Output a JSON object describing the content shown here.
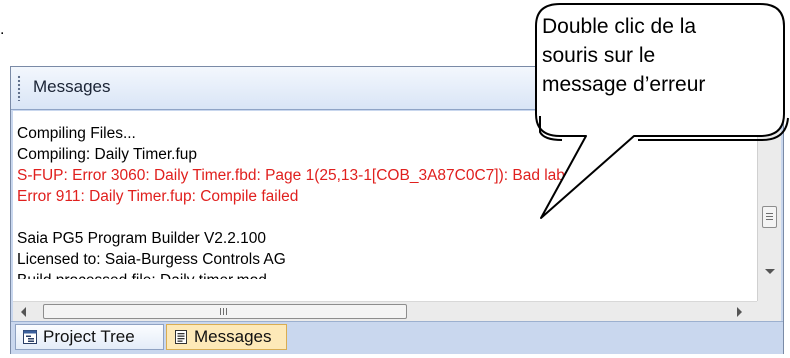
{
  "panel": {
    "title": "Messages"
  },
  "messages": [
    {
      "text": "Compiling Files...",
      "kind": "info"
    },
    {
      "text": "Compiling: Daily Timer.fup",
      "kind": "info"
    },
    {
      "text": "S-FUP: Error 3060: Daily Timer.fbd: Page 1(25,13-1[COB_3A87C0C7]): Bad label",
      "kind": "error"
    },
    {
      "text": "Error 911: Daily Timer.fup: Compile failed",
      "kind": "error"
    },
    {
      "text": "",
      "kind": "blank"
    },
    {
      "text": "Saia PG5 Program Builder V2.2.100",
      "kind": "info"
    },
    {
      "text": "Licensed to: Saia-Burgess Controls AG",
      "kind": "info"
    },
    {
      "text": "Build processed file: Daily timer.mod",
      "kind": "info"
    }
  ],
  "tabs": [
    {
      "label": "Project Tree",
      "active": false,
      "icon": "project-tree-icon"
    },
    {
      "label": "Messages",
      "active": true,
      "icon": "messages-icon"
    }
  ],
  "callout": {
    "lines": [
      "Double clic de la",
      "souris sur le",
      "message d’erreur"
    ]
  },
  "colors": {
    "error_text": "#e0201e",
    "panel_background": "#c9d7ee",
    "active_tab": "#fde9b8"
  }
}
